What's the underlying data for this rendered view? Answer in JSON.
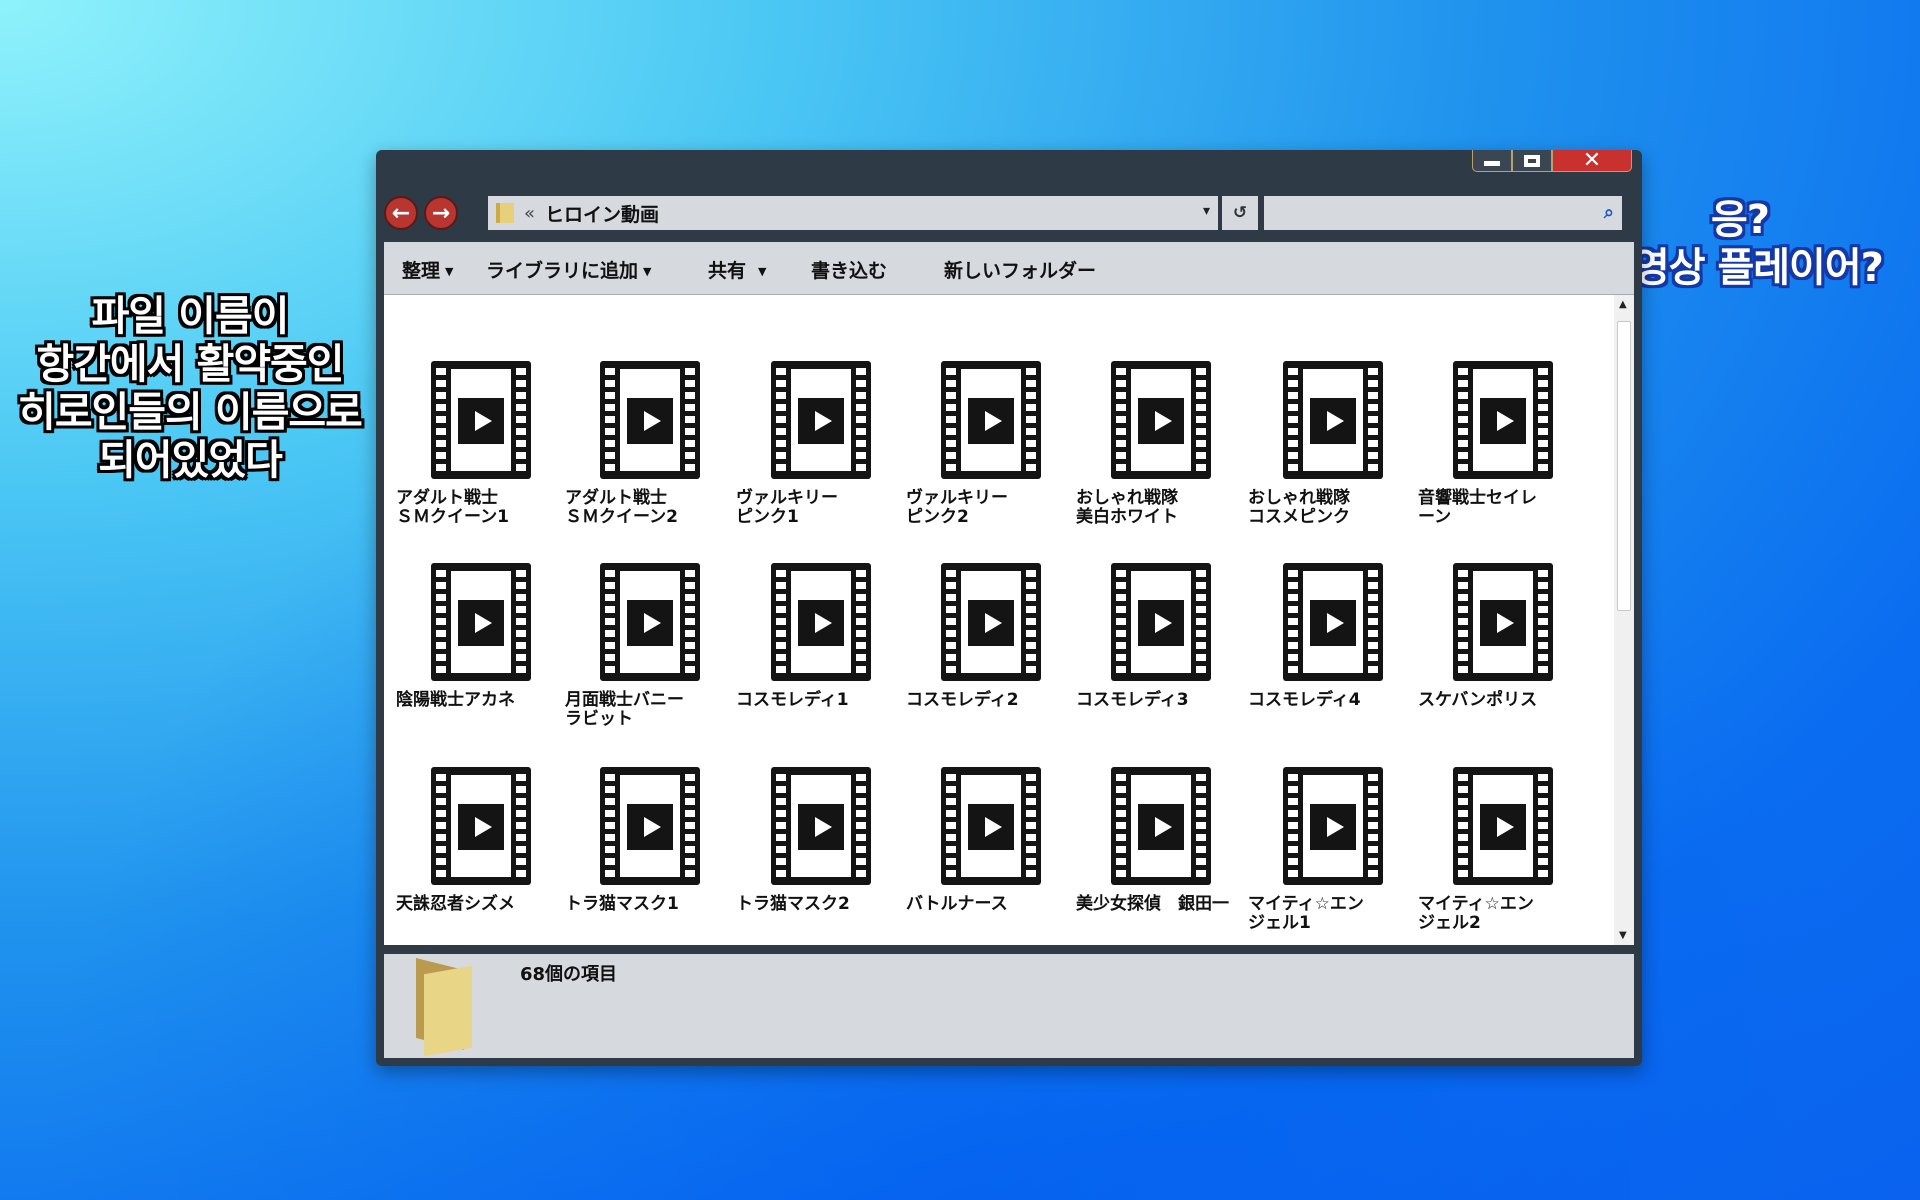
{
  "captions": {
    "left": [
      "파일 이름이",
      "항간에서 활약중인",
      "히로인들의 이름으로",
      "되어있었다"
    ],
    "right": [
      "응?",
      "동영상 플레이어?"
    ]
  },
  "window": {
    "controls": {
      "minimize": "minimize-icon",
      "maximize": "maximize-icon",
      "close": "✕"
    },
    "nav": {
      "back": "←",
      "forward": "→"
    },
    "address": {
      "separator": "«",
      "path": "ヒロイン動画",
      "dropdown": "▾"
    },
    "refresh": "↺",
    "search": {
      "placeholder": "",
      "icon": "⌕"
    },
    "toolbar": {
      "organize": "整理",
      "add_to_library": "ライブラリに追加",
      "share": "共有",
      "burn": "書き込む",
      "new_folder": "新しいフォルダー"
    },
    "files": [
      "アダルト戦士\nＳＭクイーン1",
      "アダルト戦士\nＳＭクイーン2",
      "ヴァルキリー\nピンク1",
      "ヴァルキリー\nピンク2",
      "おしゃれ戦隊\n美白ホワイト",
      "おしゃれ戦隊\nコスメピンク",
      "音響戦士セイレ\nーン",
      "陰陽戦士アカネ",
      "月面戦士バニー\nラビット",
      "コスモレディ1",
      "コスモレディ2",
      "コスモレディ3",
      "コスモレディ4",
      "スケバンポリス",
      "天誅忍者シズメ",
      "トラ猫マスク1",
      "トラ猫マスク2",
      "バトルナース",
      "美少女探偵　銀田一",
      "マイティ☆エン\nジェル1",
      "マイティ☆エン\nジェル2"
    ],
    "status": {
      "item_count": "68個の項目"
    }
  },
  "colors": {
    "close_button": "#c8312e",
    "nav_button": "#b83530",
    "frame": "#2e3a46",
    "panel": "#d6d9de"
  }
}
